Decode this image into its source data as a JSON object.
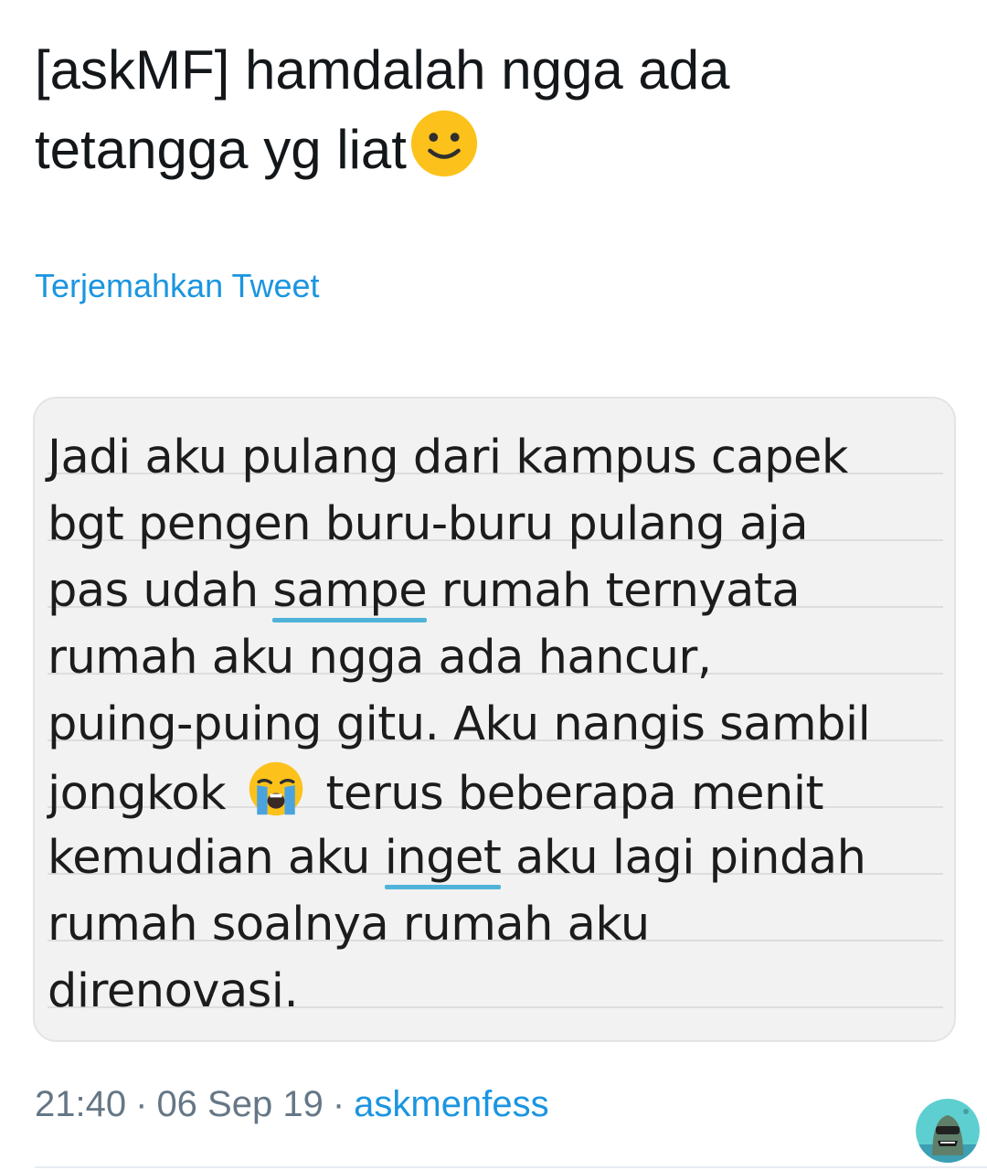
{
  "tweet": {
    "text": "[askMF] hamdalah ngga ada tetangga yg liat",
    "emoji": "smiling-face-icon"
  },
  "translate_link": "Terjemahkan Tweet",
  "media": {
    "lines": [
      "Jadi aku pulang dari kampus capek",
      "bgt pengen buru-buru pulang aja",
      "pas udah ",
      "sampe",
      " rumah ternyata",
      "rumah aku ngga ada hancur,",
      "puing-puing gitu. Aku nangis sambil",
      "jongkok ",
      " terus beberapa menit",
      "kemudian aku ",
      "inget",
      " aku lagi pindah",
      "rumah soalnya rumah aku",
      "direnovasi."
    ],
    "emoji": "loudly-crying-face-icon",
    "spellcheck_color": "#4fb3d9"
  },
  "meta": {
    "time": "21:40",
    "date": "06 Sep 19",
    "separator": "·",
    "source": "askmenfess"
  },
  "colors": {
    "link": "#1b95e0",
    "meta": "#657786",
    "text": "#14171a"
  }
}
